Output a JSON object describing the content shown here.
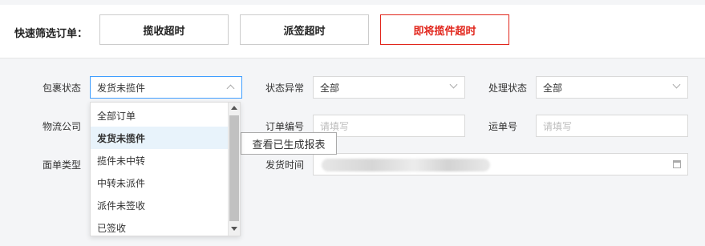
{
  "quick_filter": {
    "label": "快速筛选订单：",
    "buttons": [
      {
        "label": "揽收超时",
        "active": false
      },
      {
        "label": "派签超时",
        "active": false
      },
      {
        "label": "即将揽件超时",
        "active": true
      }
    ]
  },
  "filters": {
    "package_status": {
      "label": "包裹状态",
      "value": "发货未揽件"
    },
    "status_abnormal": {
      "label": "状态异常",
      "value": "全部"
    },
    "process_status": {
      "label": "处理状态",
      "value": "全部"
    },
    "logistics_company": {
      "label": "物流公司"
    },
    "order_no": {
      "label": "订单编号",
      "placeholder": "请填写"
    },
    "waybill_no": {
      "label": "运单号",
      "placeholder": "请填写"
    },
    "waybill_type": {
      "label": "面单类型"
    },
    "ship_time": {
      "label": "发货时间"
    }
  },
  "report_button": "查看已生成报表",
  "dropdown_options": [
    "全部订单",
    "发货未揽件",
    "揽件未中转",
    "中转未派件",
    "派件未签收",
    "已签收"
  ],
  "dropdown_selected_index": 1,
  "colors": {
    "accent_red": "#e1251b",
    "focus_blue": "#409eff"
  }
}
